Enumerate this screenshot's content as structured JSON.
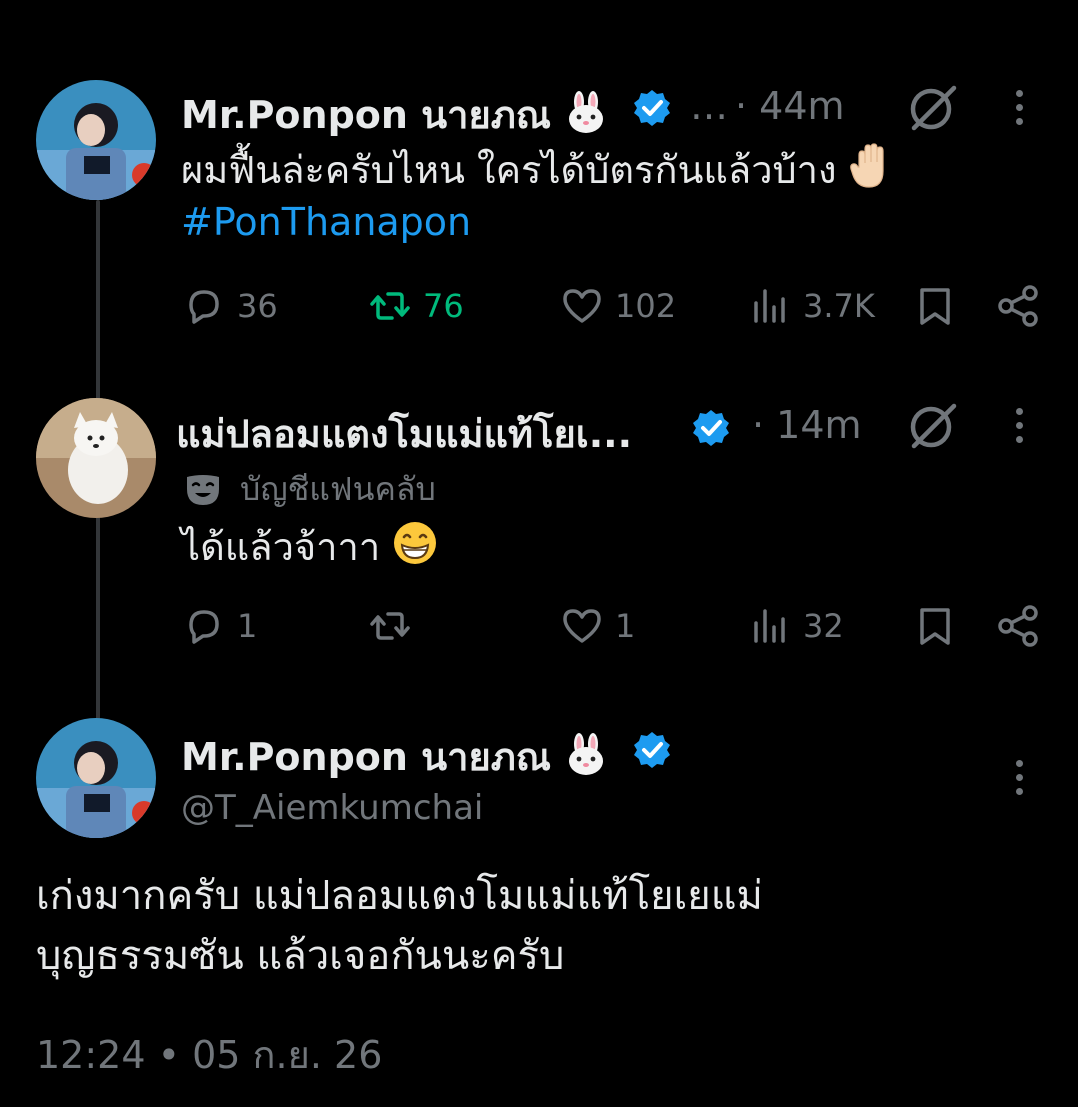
{
  "tweets": [
    {
      "author": "Mr.Ponpon นายภณ",
      "ellipsis": "…",
      "time": "· 44m",
      "text": "ผมฟื้นล่ะครับไหน ใครได้บัตรกันแล้วบ้าง",
      "hashtag": "#PonThanapon",
      "replies": "36",
      "retweets": "76",
      "likes": "102",
      "views": "3.7K"
    },
    {
      "author": "แม่ปลอมแตงโมแม่แท้โยเ...",
      "time": "· 14m",
      "badge": "บัญชีแฟนคลับ",
      "text": "ได้แล้วจ้าาา",
      "replies": "1",
      "likes": "1",
      "views": "32"
    }
  ],
  "main": {
    "author": "Mr.Ponpon นายภณ",
    "handle": "@T_Aiemkumchai",
    "text_line1": "เก่งมากครับ แม่ปลอมแตงโมแม่แท้โยเยแม่",
    "text_line2": "บุญธรรมซัน แล้วเจอกันนะครับ",
    "timestamp": "12:24 • 05 ก.ย. 26"
  },
  "colors": {
    "background": "#000000",
    "text": "#e7e9ea",
    "muted": "#71767b",
    "accent": "#1d9bf0",
    "retweet_active": "#00ba7c",
    "thread_line": "#333639"
  },
  "icons": [
    "reply-icon",
    "retweet-icon",
    "like-icon",
    "views-icon",
    "bookmark-icon",
    "share-icon",
    "grok-icon",
    "more-icon",
    "verified-icon",
    "rabbit-emoji",
    "hand-emoji",
    "grin-emoji",
    "mask-icon"
  ]
}
